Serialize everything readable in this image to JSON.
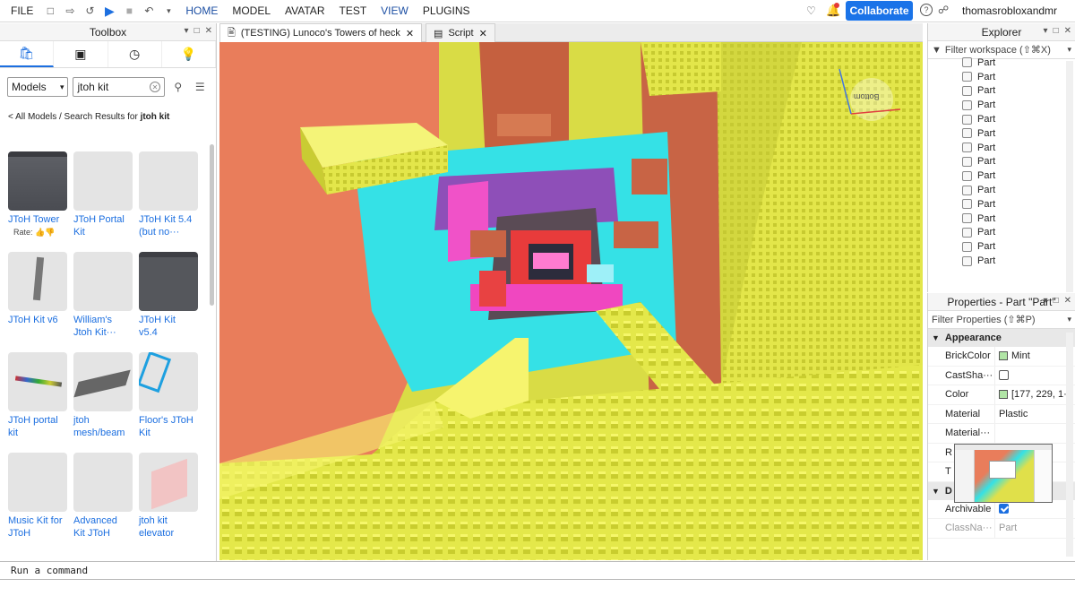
{
  "menubar": {
    "file": "FILE",
    "tabs": [
      "HOME",
      "MODEL",
      "AVATAR",
      "TEST",
      "VIEW",
      "PLUGINS"
    ],
    "collaborate": "Collaborate",
    "username": "thomasrobloxandmr"
  },
  "toolbox": {
    "title": "Toolbox",
    "category": "Models",
    "search_value": "jtoh kit",
    "breadcrumb_prefix": "< All Models / Search Results for ",
    "breadcrumb_query": "jtoh kit",
    "rate_label": "Rate:",
    "items": [
      {
        "name": "JToH Tower"
      },
      {
        "name": "JToH Portal\nKit"
      },
      {
        "name": "JToH Kit 5.4\n(but no···"
      },
      {
        "name": "JToH Kit v6"
      },
      {
        "name": "William's\nJtoh Kit···"
      },
      {
        "name": "JToH Kit\nv5.4"
      },
      {
        "name": "JToH portal\nkit"
      },
      {
        "name": "jtoh\nmesh/beam"
      },
      {
        "name": "Floor's JToH\nKit"
      },
      {
        "name": "Music Kit for\nJToH"
      },
      {
        "name": "Advanced\nKit JToH"
      },
      {
        "name": "jtoh kit\nelevator"
      }
    ]
  },
  "doc_tabs": {
    "place": "(TESTING) Lunoco's Towers of heck",
    "script": "Script"
  },
  "viewport": {
    "orient_label": "Bottom"
  },
  "explorer": {
    "title": "Explorer",
    "filter_placeholder": "Filter workspace (⇧⌘X)",
    "rows": [
      "Part",
      "Part",
      "Part",
      "Part",
      "Part",
      "Part",
      "Part",
      "Part",
      "Part",
      "Part",
      "Part",
      "Part",
      "Part",
      "Part",
      "Part"
    ]
  },
  "properties": {
    "title": "Properties - Part \"Part\"",
    "filter_placeholder": "Filter Properties (⇧⌘P)",
    "section_appearance": "Appearance",
    "section_data": "D",
    "rows": [
      {
        "name": "BrickColor",
        "value": "Mint"
      },
      {
        "name": "CastSha···",
        "value": ""
      },
      {
        "name": "Color",
        "value": "[177, 229, 1···"
      },
      {
        "name": "Material",
        "value": "Plastic"
      },
      {
        "name": "Material···",
        "value": ""
      },
      {
        "name": "R",
        "value": ""
      },
      {
        "name": "T",
        "value": ""
      }
    ],
    "data_rows": [
      {
        "name": "Archivable",
        "value": ""
      },
      {
        "name": "ClassNa···",
        "value": "Part"
      }
    ],
    "colors": {
      "mint": "#b1e5a6"
    }
  },
  "command_bar": {
    "placeholder": "Run a command"
  }
}
